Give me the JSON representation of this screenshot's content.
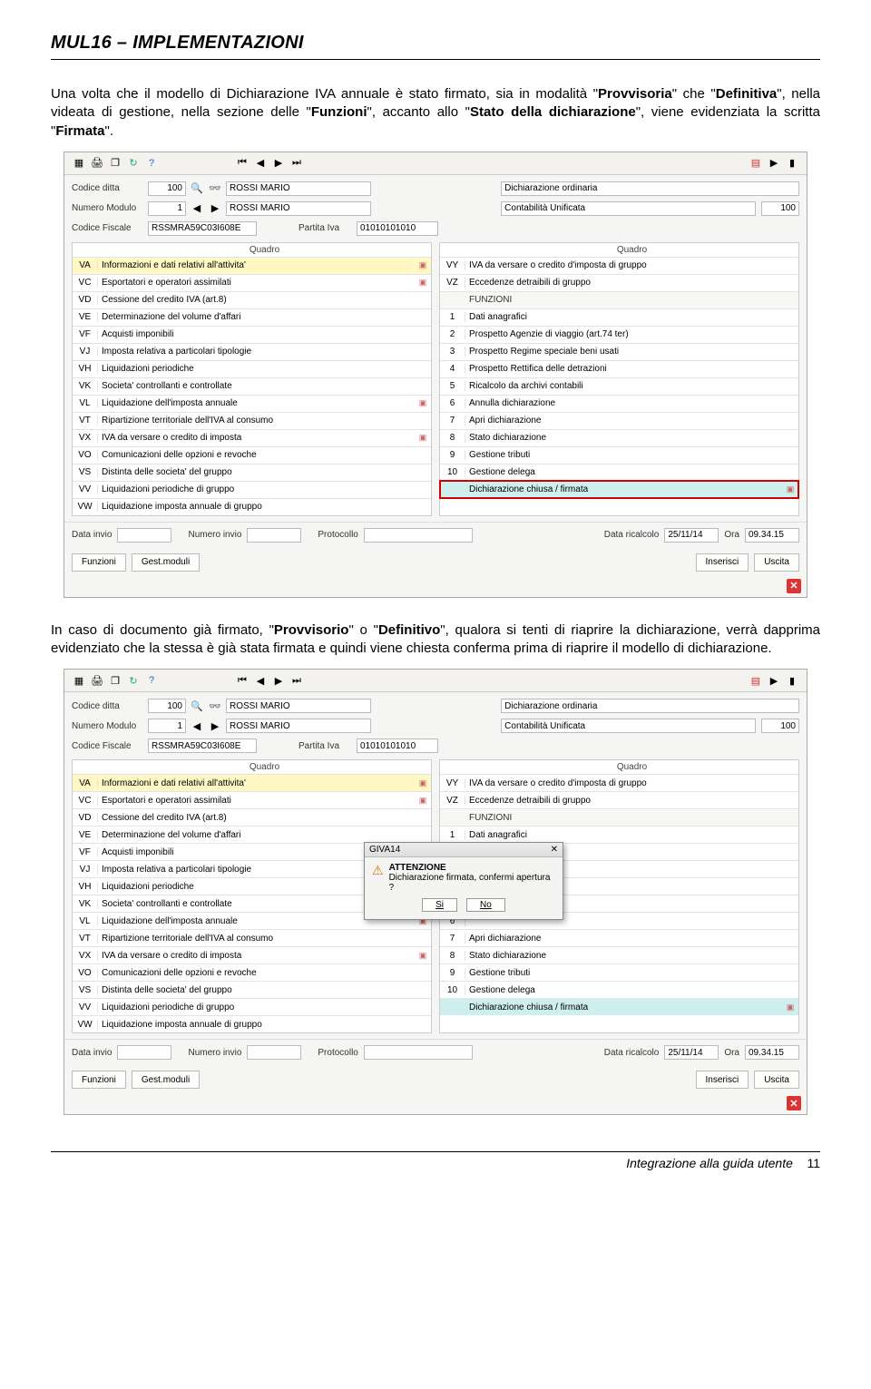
{
  "page": {
    "header": "MUL16 – IMPLEMENTAZIONI",
    "para1_a": "Una volta che il modello di Dichiarazione IVA annuale è stato firmato, sia in modalità \"",
    "para1_b": "Provvisoria",
    "para1_c": "\" che \"",
    "para1_d": "Definitiva",
    "para1_e": "\", nella videata di gestione, nella sezione delle \"",
    "para1_f": "Funzioni",
    "para1_g": "\", accanto allo \"",
    "para1_h": "Stato della dichiarazione",
    "para1_i": "\", viene evidenziata la scritta \"",
    "para1_j": "Firmata",
    "para1_k": "\".",
    "para2_a": "In caso di documento già firmato, \"",
    "para2_b": "Provvisorio",
    "para2_c": "\" o \"",
    "para2_d": "Definitivo",
    "para2_e": "\", qualora si tenti di riaprire la dichiarazione, verrà dapprima evidenziato che la stessa è già stata firmata e quindi viene chiesta conferma prima di riaprire il modello di dichiarazione.",
    "footer_text": "Integrazione alla guida utente",
    "footer_page": "11"
  },
  "app": {
    "labels": {
      "codice_ditta": "Codice ditta",
      "numero_modulo": "Numero Modulo",
      "codice_fiscale": "Codice Fiscale",
      "partita_iva": "Partita Iva",
      "quadro": "Quadro",
      "funzioni": "FUNZIONI",
      "data_invio": "Data invio",
      "numero_invio": "Numero invio",
      "protocollo": "Protocollo",
      "data_ricalcolo": "Data ricalcolo",
      "ora": "Ora"
    },
    "values": {
      "codice_ditta": "100",
      "nome1": "ROSSI MARIO",
      "numero_modulo": "1",
      "nome2": "ROSSI MARIO",
      "codice_fiscale": "RSSMRA59C03I608E",
      "partita_iva": "01010101010",
      "dich_tipo": "Dichiarazione ordinaria",
      "cont_tipo": "Contabilità Unificata",
      "cont_num": "100",
      "data_ricalcolo": "25/11/14",
      "ora": "09.34.15"
    },
    "buttons": {
      "funzioni": "Funzioni",
      "gest_moduli": "Gest.moduli",
      "inserisci": "Inserisci",
      "uscita": "Uscita"
    },
    "left_rows": [
      {
        "code": "VA",
        "desc": "Informazioni e dati relativi all'attivita'",
        "icon": true,
        "hl": "yellow"
      },
      {
        "code": "VC",
        "desc": "Esportatori e operatori assimilati",
        "icon": true
      },
      {
        "code": "VD",
        "desc": "Cessione del credito IVA (art.8)"
      },
      {
        "code": "VE",
        "desc": "Determinazione del volume d'affari"
      },
      {
        "code": "VF",
        "desc": "Acquisti imponibili"
      },
      {
        "code": "VJ",
        "desc": "Imposta relativa a particolari tipologie"
      },
      {
        "code": "VH",
        "desc": "Liquidazioni periodiche"
      },
      {
        "code": "VK",
        "desc": "Societa' controllanti e controllate"
      },
      {
        "code": "VL",
        "desc": "Liquidazione dell'imposta annuale",
        "icon": true
      },
      {
        "code": "VT",
        "desc": "Ripartizione territoriale dell'IVA al consumo"
      },
      {
        "code": "VX",
        "desc": "IVA da versare o credito di imposta",
        "icon": true
      },
      {
        "code": "VO",
        "desc": "Comunicazioni delle opzioni e revoche"
      },
      {
        "code": "VS",
        "desc": "Distinta delle societa' del gruppo"
      },
      {
        "code": "VV",
        "desc": "Liquidazioni periodiche di gruppo"
      },
      {
        "code": "VW",
        "desc": "Liquidazione imposta annuale di gruppo"
      }
    ],
    "right_rows": [
      {
        "code": "VY",
        "desc": "IVA da versare o credito d'imposta di gruppo"
      },
      {
        "code": "VZ",
        "desc": "Eccedenze detraibili di gruppo"
      },
      {
        "section": "FUNZIONI"
      },
      {
        "code": "1",
        "desc": "Dati anagrafici"
      },
      {
        "code": "2",
        "desc": "Prospetto Agenzie di viaggio (art.74 ter)"
      },
      {
        "code": "3",
        "desc": "Prospetto Regime speciale beni usati"
      },
      {
        "code": "4",
        "desc": "Prospetto Rettifica delle detrazioni"
      },
      {
        "code": "5",
        "desc": "Ricalcolo da archivi contabili"
      },
      {
        "code": "6",
        "desc": "Annulla dichiarazione"
      },
      {
        "code": "7",
        "desc": "Apri dichiarazione"
      },
      {
        "code": "8",
        "desc": "Stato dichiarazione"
      },
      {
        "code": "9",
        "desc": "Gestione tributi"
      },
      {
        "code": "10",
        "desc": "Gestione delega"
      },
      {
        "code": "",
        "desc": "Dichiarazione chiusa / firmata",
        "icon": true,
        "hl": "cyan",
        "red": true
      }
    ],
    "right_rows_b": [
      {
        "code": "VY",
        "desc": "IVA da versare o credito d'imposta di gruppo"
      },
      {
        "code": "VZ",
        "desc": "Eccedenze detraibili di gruppo"
      },
      {
        "section": "FUNZIONI"
      },
      {
        "code": "1",
        "desc": "Dati anagrafici"
      },
      {
        "code": "2",
        "desc": "di viaggio (art.74 ter)",
        "partial": true
      },
      {
        "code": "3",
        "desc": "speciale beni usati",
        "partial": true
      },
      {
        "code": "4",
        "desc": "delle detrazioni",
        "partial": true
      },
      {
        "code": "5",
        "desc": "contabili",
        "partial": true
      },
      {
        "code": "6",
        "desc": "",
        "partial": true
      },
      {
        "code": "7",
        "desc": "Apri dichiarazione"
      },
      {
        "code": "8",
        "desc": "Stato dichiarazione"
      },
      {
        "code": "9",
        "desc": "Gestione tributi"
      },
      {
        "code": "10",
        "desc": "Gestione delega"
      },
      {
        "code": "",
        "desc": "Dichiarazione chiusa / firmata",
        "icon": true,
        "hl": "cyan"
      }
    ]
  },
  "dialog": {
    "title": "GIVA14",
    "heading": "ATTENZIONE",
    "text": "Dichiarazione firmata, confermi apertura ?",
    "yes": "Si",
    "no": "No"
  }
}
